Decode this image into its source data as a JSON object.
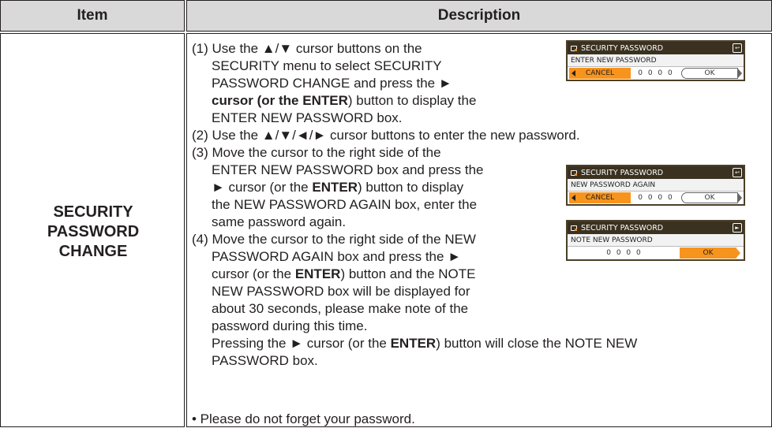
{
  "header": {
    "item": "Item",
    "description": "Description"
  },
  "item_name": [
    "SECURITY",
    "PASSWORD",
    "CHANGE"
  ],
  "steps": {
    "s1": [
      "(1) Use the ▲/▼ cursor buttons on the",
      "SECURITY menu to select SECURITY",
      "PASSWORD CHANGE and press the ►",
      "cursor (or the ENTER",
      ") button to display the",
      "ENTER NEW PASSWORD box."
    ],
    "s2": "(2) Use the ▲/▼/◄/► cursor buttons to enter the new password.",
    "s3": [
      "(3) Move the cursor to the right side of the",
      "ENTER NEW PASSWORD box and press the",
      "► cursor (or the ",
      "ENTER",
      ") button to display",
      "the NEW PASSWORD AGAIN box, enter the",
      "same password again."
    ],
    "s4": [
      "(4) Move the cursor to the right side of the NEW",
      "PASSWORD AGAIN box and press the ►",
      "cursor (or the ",
      "ENTER",
      ") button and the NOTE",
      "NEW PASSWORD box will be displayed for",
      "about 30 seconds, please make note of the",
      "password during this time.",
      "Pressing the ► cursor (or the ",
      "ENTER",
      ") button will close the NOTE NEW",
      "PASSWORD box."
    ],
    "note": "• Please do not forget your password."
  },
  "osd": [
    {
      "title": "SECURITY PASSWORD",
      "sub": "ENTER NEW PASSWORD",
      "cancel": "CANCEL",
      "digits": "0 0 0 0",
      "ok": "OK",
      "corner_icon": "return-icon"
    },
    {
      "title": "SECURITY PASSWORD",
      "sub": "NEW PASSWORD AGAIN",
      "cancel": "CANCEL",
      "digits": "0 0 0 0",
      "ok": "OK",
      "corner_icon": "return-icon"
    },
    {
      "title": "SECURITY PASSWORD",
      "sub": "NOTE NEW PASSWORD",
      "digits": "0 0 0 0",
      "ok": "OK",
      "corner_icon": "next-icon"
    }
  ],
  "colors": {
    "header_bg": "#d9d9d9",
    "accent": "#f7941d",
    "osd_title_bg": "#3a3120"
  }
}
